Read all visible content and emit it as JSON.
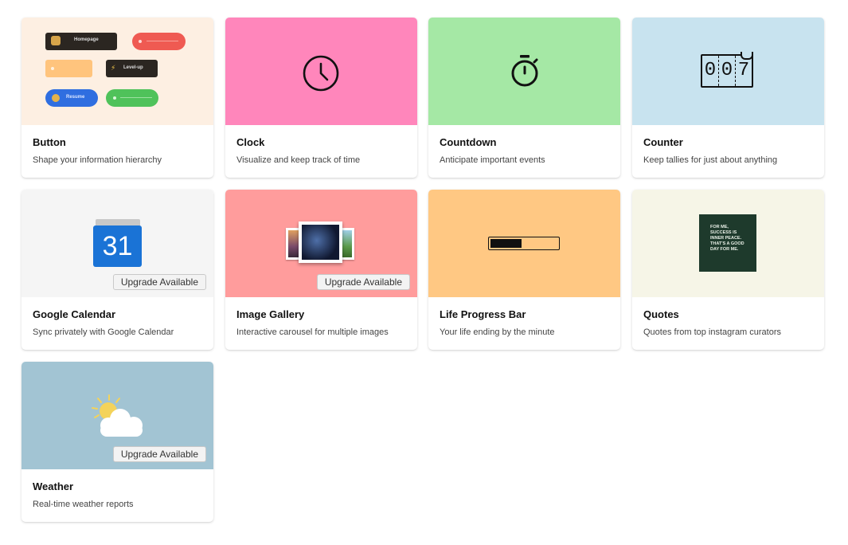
{
  "upgrade_label": "Upgrade Available",
  "cards": [
    {
      "title": "Button",
      "desc": "Shape your information hierarchy",
      "bg": "#fdefe2"
    },
    {
      "title": "Clock",
      "desc": "Visualize and keep track of time",
      "bg": "#ff86bb"
    },
    {
      "title": "Countdown",
      "desc": "Anticipate important events",
      "bg": "#a5e8a5"
    },
    {
      "title": "Counter",
      "desc": "Keep tallies for just about anything",
      "bg": "#c8e3ef"
    },
    {
      "title": "Google Calendar",
      "desc": "Sync privately with Google Calendar",
      "bg": "#f5f5f5"
    },
    {
      "title": "Image Gallery",
      "desc": "Interactive carousel for multiple images",
      "bg": "#ff9c9c"
    },
    {
      "title": "Life Progress Bar",
      "desc": "Your life ending by the minute",
      "bg": "#ffc883"
    },
    {
      "title": "Quotes",
      "desc": "Quotes from top instagram curators",
      "bg": "#f6f5e7"
    },
    {
      "title": "Weather",
      "desc": "Real-time weather reports",
      "bg": "#a2c4d3"
    }
  ],
  "button_preview": {
    "homepage_label": "Homepage",
    "levelup_label": "Level-up",
    "resume_label": "Resume"
  },
  "counter_preview": {
    "digits": [
      "0",
      "0",
      "7"
    ]
  },
  "calendar_preview": {
    "day": "31"
  },
  "progress_preview": {
    "fill_fraction": 0.46
  },
  "quote_preview": {
    "text": "FOR ME, SUCCESS IS INNER PEACE. THAT'S A GOOD DAY FOR ME."
  }
}
